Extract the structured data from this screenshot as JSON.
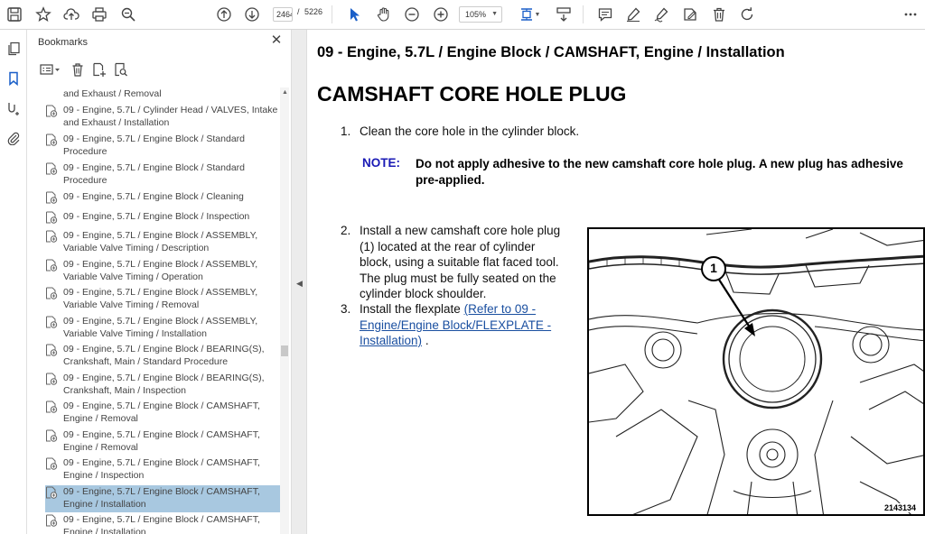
{
  "toolbar": {
    "page_current": "2464",
    "page_separator": "/",
    "page_total": "5226",
    "zoom": "105%"
  },
  "bookmarks_panel": {
    "title": "Bookmarks",
    "items": [
      {
        "label": "and Exhaust / Removal",
        "selected": false
      },
      {
        "label": "09 - Engine, 5.7L / Cylinder Head / VALVES, Intake and Exhaust / Installation",
        "selected": false
      },
      {
        "label": "09 - Engine, 5.7L / Engine Block / Standard Procedure",
        "selected": false
      },
      {
        "label": "09 - Engine, 5.7L / Engine Block / Standard Procedure",
        "selected": false
      },
      {
        "label": "09 - Engine, 5.7L / Engine Block / Cleaning",
        "selected": false
      },
      {
        "label": "09 - Engine, 5.7L / Engine Block / Inspection",
        "selected": false
      },
      {
        "label": "09 - Engine, 5.7L / Engine Block / ASSEMBLY, Variable Valve Timing / Description",
        "selected": false
      },
      {
        "label": "09 - Engine, 5.7L / Engine Block / ASSEMBLY, Variable Valve Timing / Operation",
        "selected": false
      },
      {
        "label": "09 - Engine, 5.7L / Engine Block / ASSEMBLY, Variable Valve Timing / Removal",
        "selected": false
      },
      {
        "label": "09 - Engine, 5.7L / Engine Block / ASSEMBLY, Variable Valve Timing / Installation",
        "selected": false
      },
      {
        "label": "09 - Engine, 5.7L / Engine Block / BEARING(S), Crankshaft, Main / Standard Procedure",
        "selected": false
      },
      {
        "label": "09 - Engine, 5.7L / Engine Block / BEARING(S), Crankshaft, Main / Inspection",
        "selected": false
      },
      {
        "label": "09 - Engine, 5.7L / Engine Block / CAMSHAFT, Engine / Removal",
        "selected": false
      },
      {
        "label": "09 - Engine, 5.7L / Engine Block / CAMSHAFT, Engine / Removal",
        "selected": false
      },
      {
        "label": "09 - Engine, 5.7L / Engine Block / CAMSHAFT, Engine / Inspection",
        "selected": false
      },
      {
        "label": "09 - Engine, 5.7L / Engine Block / CAMSHAFT, Engine / Installation",
        "selected": true
      },
      {
        "label": "09 - Engine, 5.7L / Engine Block / CAMSHAFT, Engine / Installation",
        "selected": false
      }
    ]
  },
  "document": {
    "breadcrumb": "09 - Engine, 5.7L / Engine Block / CAMSHAFT, Engine / Installation",
    "heading": "CAMSHAFT CORE HOLE PLUG",
    "step1_num": "1.",
    "step1_text": "Clean the core hole in the cylinder block.",
    "note_label": "NOTE:",
    "note_text": "Do not apply adhesive to the new camshaft core hole plug. A new plug has adhesive pre-applied.",
    "step2_num": "2.",
    "step2_lines": [
      "Install a new camshaft core hole plug",
      "(1) located at the rear of cylinder",
      "block, using a suitable flat faced tool.",
      "The plug must be fully seated on the",
      "cylinder block shoulder."
    ],
    "step3_num": "3.",
    "step3_prefix": "Install the flexplate ",
    "step3_link_lines": [
      "(Refer to 09 -",
      "Engine/Engine Block/FLEXPLATE -",
      "Installation)"
    ],
    "step3_suffix": ".",
    "figure_callout": "1",
    "figure_id": "2143134"
  }
}
